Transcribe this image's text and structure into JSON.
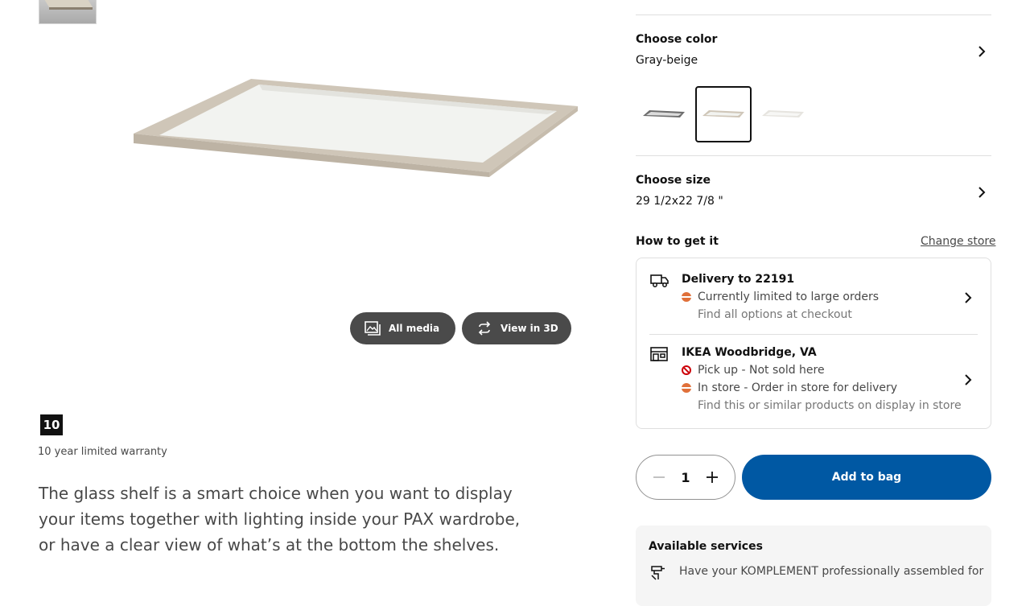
{
  "gallery": {
    "all_media_label": "All media",
    "view_3d_label": "View in 3D"
  },
  "warranty": {
    "badge": "10",
    "text": "10 year limited warranty"
  },
  "description": "The glass shelf is a smart choice when you want to display your items together with lighting inside your PAX wardrobe, or have a clear view of what’s at the bottom the shelves.",
  "color": {
    "heading": "Choose color",
    "selected": "Gray-beige",
    "swatches": [
      "dark-gray",
      "gray-beige",
      "white"
    ]
  },
  "size": {
    "heading": "Choose size",
    "selected": "29 1/2x22 7/8 \""
  },
  "availability": {
    "heading": "How to get it",
    "change_store": "Change store",
    "delivery": {
      "title": "Delivery to 22191",
      "status": "Currently limited to large orders",
      "note": "Find all options at checkout"
    },
    "store": {
      "title": "IKEA Woodbridge, VA",
      "pickup": "Pick up - Not sold here",
      "instore": "In store - Order in store for delivery",
      "note": "Find this or similar products on display in store"
    }
  },
  "purchase": {
    "quantity": "1",
    "add_to_bag": "Add to bag"
  },
  "services": {
    "title": "Available services",
    "text": "Have your KOMPLEMENT professionally assembled for"
  },
  "colors": {
    "primary_blue": "#0058a3",
    "dark_button": "#4a4a4a",
    "limited_orange": "#e0703a",
    "unavailable_red": "#cc0008"
  }
}
